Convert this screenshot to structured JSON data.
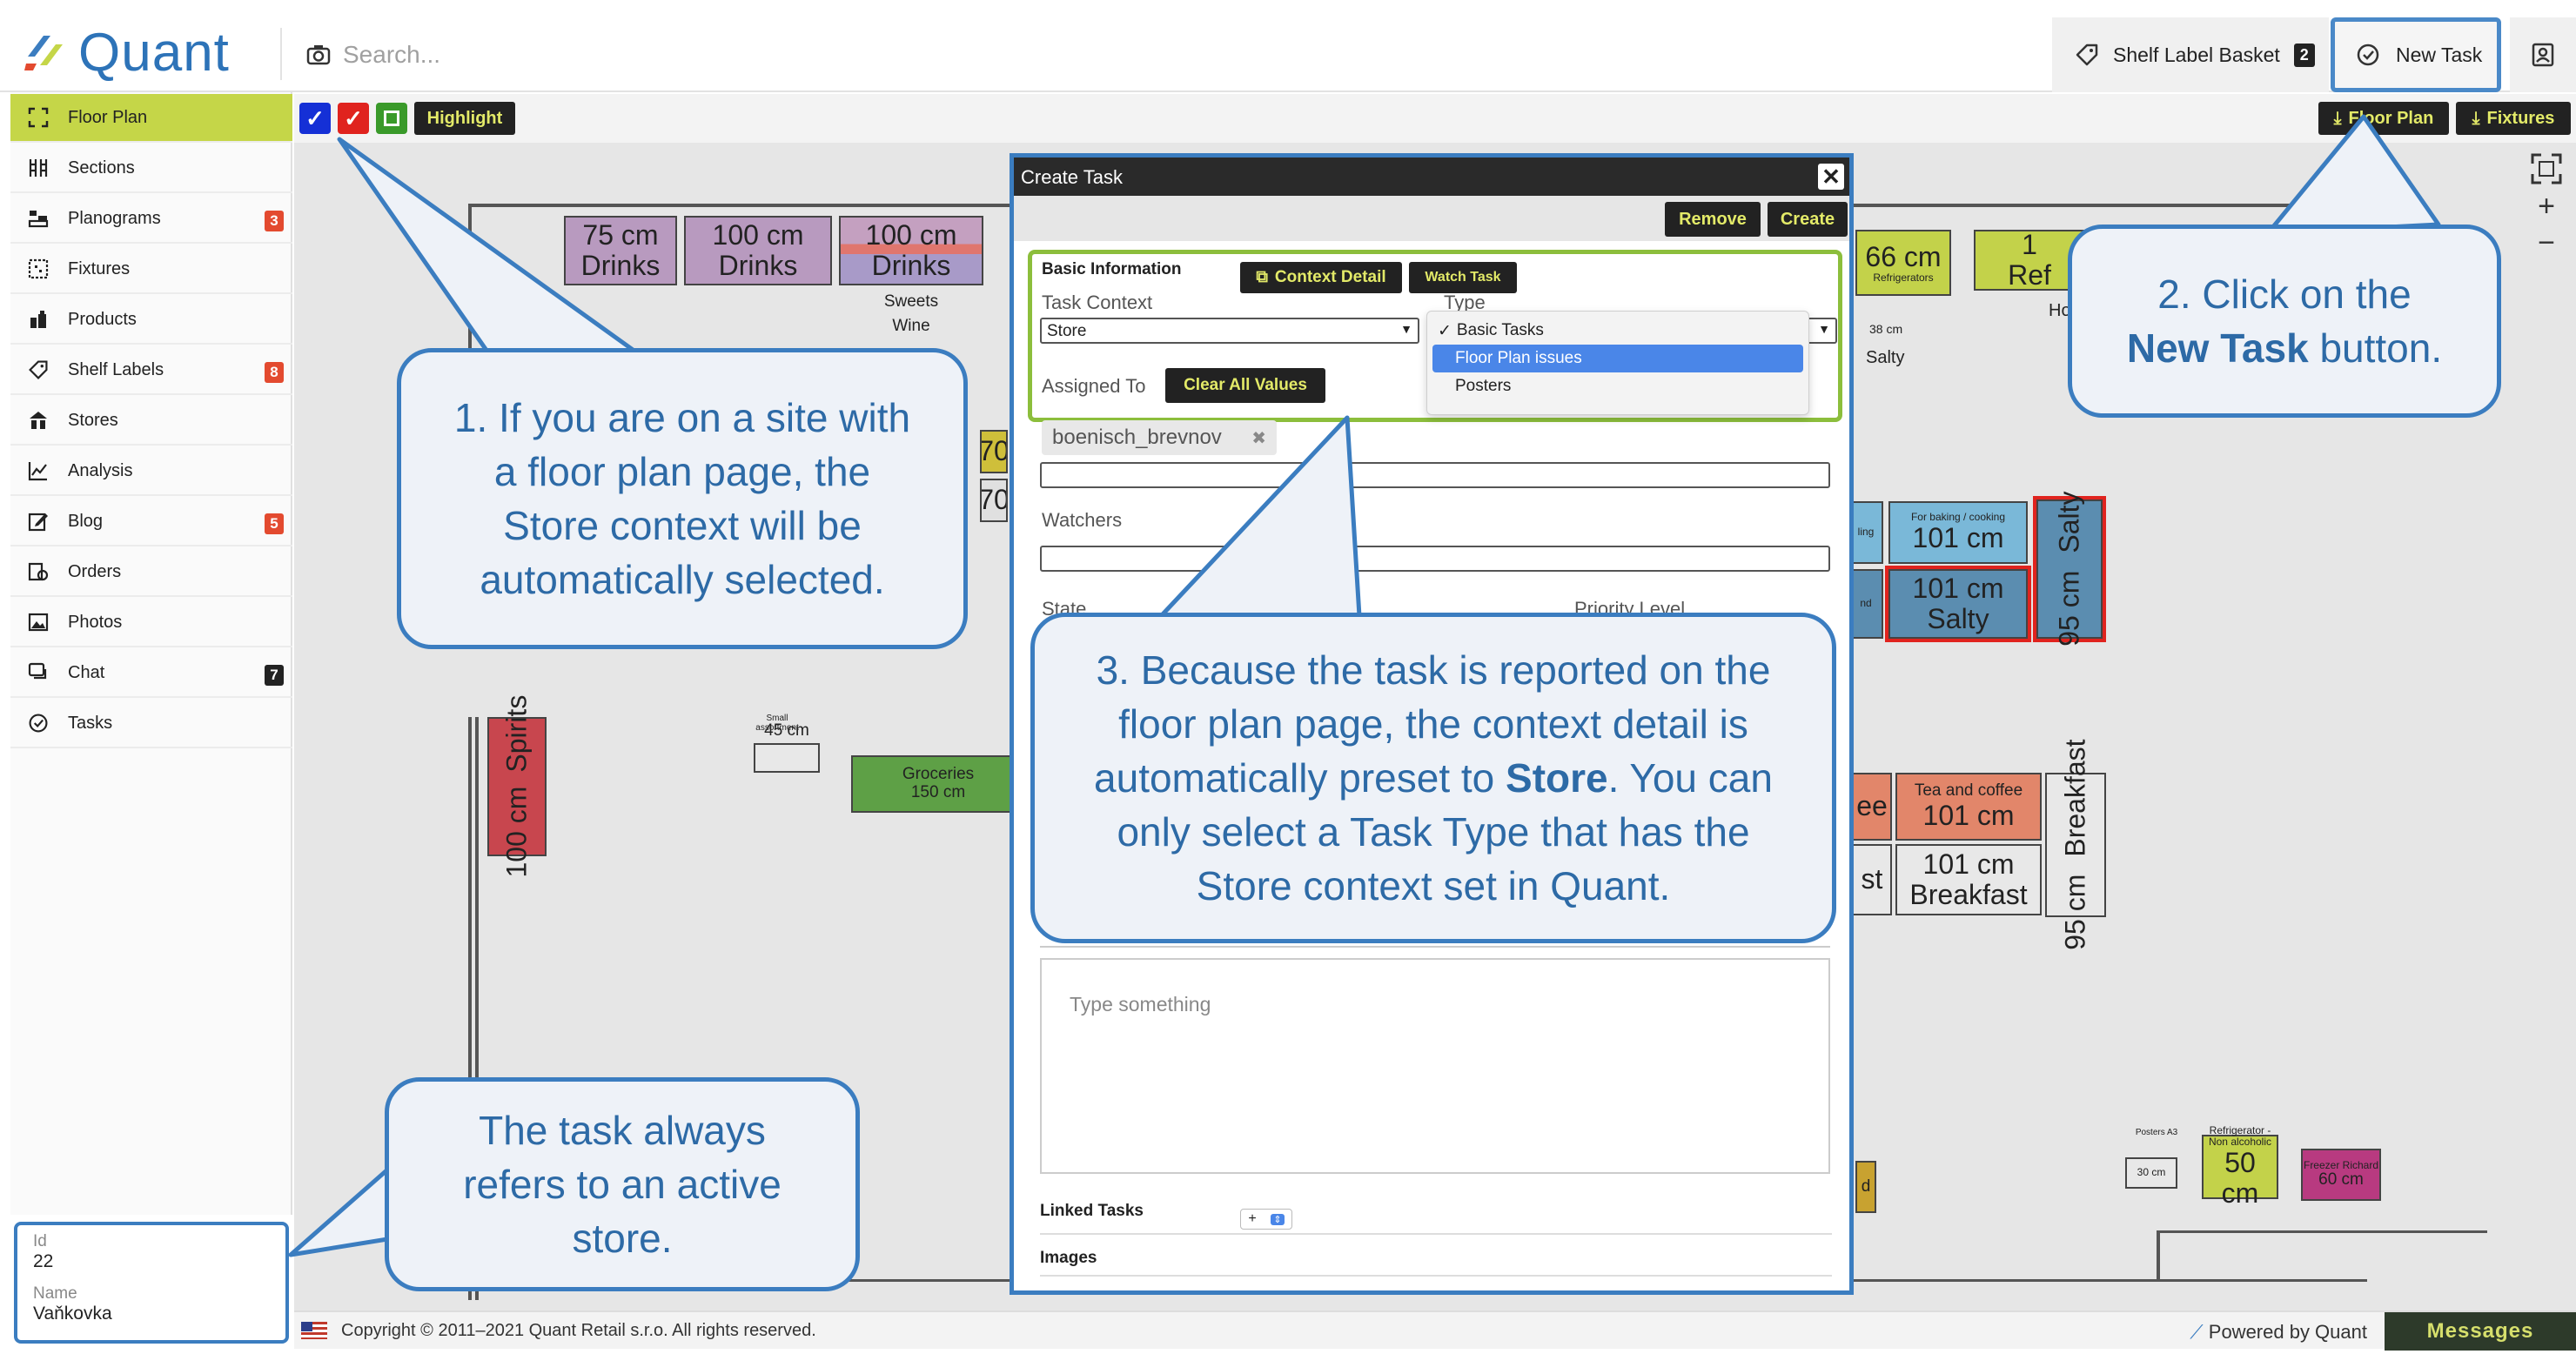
{
  "app": {
    "name": "Quant"
  },
  "search": {
    "placeholder": "Search..."
  },
  "topbar": {
    "basket_label": "Shelf Label Basket",
    "basket_count": "2",
    "new_task_label": "New Task"
  },
  "sidebar": {
    "items": [
      {
        "label": "Floor Plan",
        "icon": "frame-icon",
        "badge": ""
      },
      {
        "label": "Sections",
        "icon": "columns-icon",
        "badge": ""
      },
      {
        "label": "Planograms",
        "icon": "planogram-icon",
        "badge": "3"
      },
      {
        "label": "Fixtures",
        "icon": "grid-icon",
        "badge": ""
      },
      {
        "label": "Products",
        "icon": "products-icon",
        "badge": ""
      },
      {
        "label": "Shelf Labels",
        "icon": "tag-icon",
        "badge": "8"
      },
      {
        "label": "Stores",
        "icon": "store-icon",
        "badge": ""
      },
      {
        "label": "Analysis",
        "icon": "chart-icon",
        "badge": ""
      },
      {
        "label": "Blog",
        "icon": "edit-icon",
        "badge": "5"
      },
      {
        "label": "Orders",
        "icon": "orders-icon",
        "badge": ""
      },
      {
        "label": "Photos",
        "icon": "photo-icon",
        "badge": ""
      },
      {
        "label": "Chat",
        "icon": "chat-icon",
        "badge": "7"
      },
      {
        "label": "Tasks",
        "icon": "check-circle-icon",
        "badge": ""
      }
    ],
    "store": {
      "id_label": "Id",
      "id_value": "22",
      "name_label": "Name",
      "name_value": "Vaňkovka"
    }
  },
  "toolbar": {
    "highlight_label": "Highlight",
    "floor_plan_label": "Floor Plan",
    "fixtures_label": "Fixtures"
  },
  "floorplan": {
    "fixtures": [
      {
        "size": "75 cm",
        "name": "Drinks"
      },
      {
        "size": "100 cm",
        "name": "Drinks"
      },
      {
        "size": "100 cm",
        "name": "Drinks",
        "sub1": "Sweets",
        "sub2": "Wine"
      },
      {
        "size": "66 cm",
        "name": "Refrigerators",
        "sub1": "38 cm",
        "sub2": "Salty"
      },
      {
        "size": "1",
        "name": "Ref",
        "sub1": "Ho"
      },
      {
        "size": "101 cm",
        "name": "For baking / cooking"
      },
      {
        "size": "101 cm",
        "name": "Salty"
      },
      {
        "size": "95 cm",
        "name": "Salty"
      },
      {
        "size": "100 cm",
        "name": "Spirits"
      },
      {
        "size": "45 cm",
        "name": "Small assortment"
      },
      {
        "size": "150 cm",
        "name": "Groceries"
      },
      {
        "size": "101 cm",
        "name": "Tea and coffee"
      },
      {
        "size": "101 cm",
        "name": "Breakfast"
      },
      {
        "size": "95 cm",
        "name": "Breakfast"
      },
      {
        "size": "30 cm",
        "name": "Posters A3"
      },
      {
        "size": "50 cm",
        "name": "Refrigerator - Non alcoholic"
      },
      {
        "size": "60 cm",
        "name": "Freezer Richard"
      },
      {
        "size": "70",
        "name": ""
      },
      {
        "size": "70",
        "name": ""
      }
    ],
    "fragments": {
      "ling": "ling",
      "nd": "nd",
      "ee": "ee",
      "st": "st",
      "d": "d"
    }
  },
  "modal": {
    "title": "Create Task",
    "remove_label": "Remove",
    "create_label": "Create",
    "basic_info_label": "Basic Information",
    "context_detail_label": "Context Detail",
    "watch_task_label": "Watch Task",
    "task_context_label": "Task Context",
    "task_context_value": "Store",
    "type_label": "Type",
    "type_options": [
      "Basic Tasks",
      "Floor Plan issues",
      "Posters"
    ],
    "type_selected": "Basic Tasks",
    "assigned_to_label": "Assigned To",
    "clear_all_label": "Clear All Values",
    "assignee": "boenisch_brevnov",
    "watchers_label": "Watchers",
    "state_label": "State",
    "priority_label": "Priority Level",
    "editor_placeholder": "Type something",
    "linked_tasks_label": "Linked Tasks",
    "images_label": "Images"
  },
  "footer": {
    "copyright": "Copyright © 2011–2021 Quant Retail s.r.o. All rights reserved.",
    "powered": "Powered by Quant",
    "messages": "Messages"
  },
  "callouts": {
    "c1": [
      "1. If you are on a site with",
      "a floor plan page, the",
      "Store context will be",
      "automatically selected."
    ],
    "c2_line1": "2. Click on the",
    "c2_bold": "New Task",
    "c2_rest": " button.",
    "c3_line1": "3. Because the task is reported on the",
    "c3_line2": "floor plan page, the context detail is",
    "c3_line3a": "automatically preset to ",
    "c3_bold": "Store",
    "c3_line3b": ". You can",
    "c3_line4": "only select a Task Type that has the",
    "c3_line5": "Store context set in Quant.",
    "c4": [
      "The task always",
      "refers to an active",
      "store."
    ]
  },
  "colors": {
    "accent": "#c5d648",
    "callout_border": "#3b7dc0",
    "callout_text": "#2d6aa6",
    "badge_red": "#e34a2f",
    "highlight_blue": "#1530d6",
    "highlight_red": "#e0231e",
    "highlight_green": "#3a9a2a"
  }
}
